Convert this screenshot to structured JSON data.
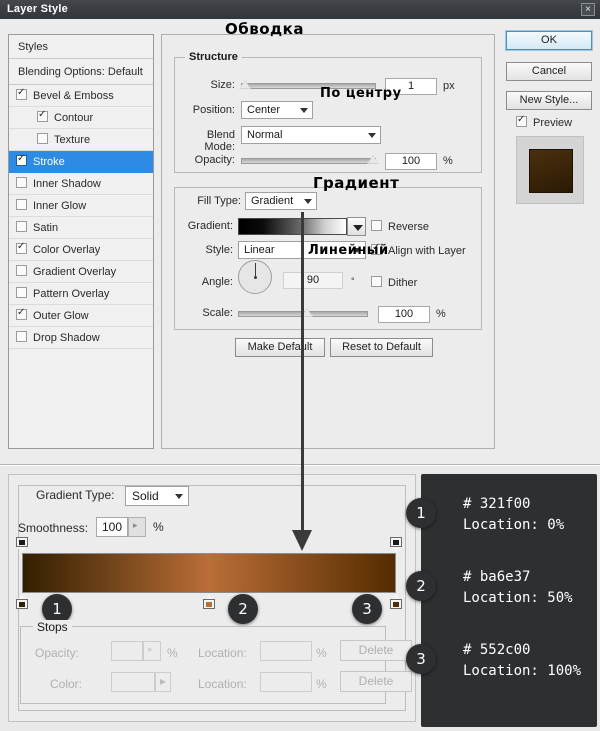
{
  "window": {
    "title": "Layer Style",
    "close_label": "×"
  },
  "styles_list": {
    "header": "Styles",
    "blending_options": "Blending Options: Default",
    "items": [
      {
        "label": "Bevel & Emboss",
        "checked": true,
        "indent": false,
        "selected": false
      },
      {
        "label": "Contour",
        "checked": true,
        "indent": true,
        "selected": false
      },
      {
        "label": "Texture",
        "checked": false,
        "indent": true,
        "selected": false
      },
      {
        "label": "Stroke",
        "checked": true,
        "indent": false,
        "selected": true
      },
      {
        "label": "Inner Shadow",
        "checked": false,
        "indent": false,
        "selected": false
      },
      {
        "label": "Inner Glow",
        "checked": false,
        "indent": false,
        "selected": false
      },
      {
        "label": "Satin",
        "checked": false,
        "indent": false,
        "selected": false
      },
      {
        "label": "Color Overlay",
        "checked": true,
        "indent": false,
        "selected": false
      },
      {
        "label": "Gradient Overlay",
        "checked": false,
        "indent": false,
        "selected": false
      },
      {
        "label": "Pattern Overlay",
        "checked": false,
        "indent": false,
        "selected": false
      },
      {
        "label": "Outer Glow",
        "checked": true,
        "indent": false,
        "selected": false
      },
      {
        "label": "Drop Shadow",
        "checked": false,
        "indent": false,
        "selected": false
      }
    ]
  },
  "stroke": {
    "group_title": "Stroke",
    "structure": {
      "title": "Structure",
      "size_label": "Size:",
      "size_value": "1",
      "size_unit": "px",
      "position_label": "Position:",
      "position_value": "Center",
      "blend_mode_label": "Blend Mode:",
      "blend_mode_value": "Normal",
      "opacity_label": "Opacity:",
      "opacity_value": "100",
      "opacity_unit": "%"
    },
    "fill": {
      "fill_type_label": "Fill Type:",
      "fill_type_value": "Gradient",
      "gradient_label": "Gradient:",
      "reverse_label": "Reverse",
      "reverse_checked": false,
      "style_label": "Style:",
      "style_value": "Linear",
      "align_label": "Align with Layer",
      "align_checked": true,
      "angle_label": "Angle:",
      "angle_value": "90",
      "angle_unit": "°",
      "dither_label": "Dither",
      "dither_checked": false,
      "scale_label": "Scale:",
      "scale_value": "100",
      "scale_unit": "%"
    },
    "make_default": "Make Default",
    "reset_to_default": "Reset to Default"
  },
  "buttons": {
    "ok": "OK",
    "cancel": "Cancel",
    "new_style": "New Style...",
    "preview_label": "Preview",
    "preview_checked": true
  },
  "gradient_editor": {
    "gradient_type_label": "Gradient Type:",
    "gradient_type_value": "Solid",
    "smoothness_label": "Smoothness:",
    "smoothness_value": "100",
    "smoothness_unit": "%",
    "stops_title": "Stops",
    "opacity_label": "Opacity:",
    "color_label": "Color:",
    "location_label_1": "Location:",
    "location_label_2": "Location:",
    "percent": "%",
    "delete_1": "Delete",
    "delete_2": "Delete",
    "stops": [
      {
        "index": "1",
        "color": "#321f00",
        "location": "0%",
        "location_pct": 0
      },
      {
        "index": "2",
        "color": "#ba6e37",
        "location": "50%",
        "location_pct": 50
      },
      {
        "index": "3",
        "color": "#552c00",
        "location": "100%",
        "location_pct": 100
      }
    ]
  },
  "callout": {
    "entries": [
      {
        "badge": "1",
        "hex_line": "# 321f00",
        "location_line": "Location: 0%"
      },
      {
        "badge": "2",
        "hex_line": "# ba6e37",
        "location_line": "Location: 50%"
      },
      {
        "badge": "3",
        "hex_line": "# 552c00",
        "location_line": "Location: 100%"
      }
    ]
  },
  "annotations": {
    "stroke_ru": "Обводка",
    "center_ru": "По центру",
    "gradient_ru": "Градиент",
    "linear_ru": "Линейный"
  }
}
